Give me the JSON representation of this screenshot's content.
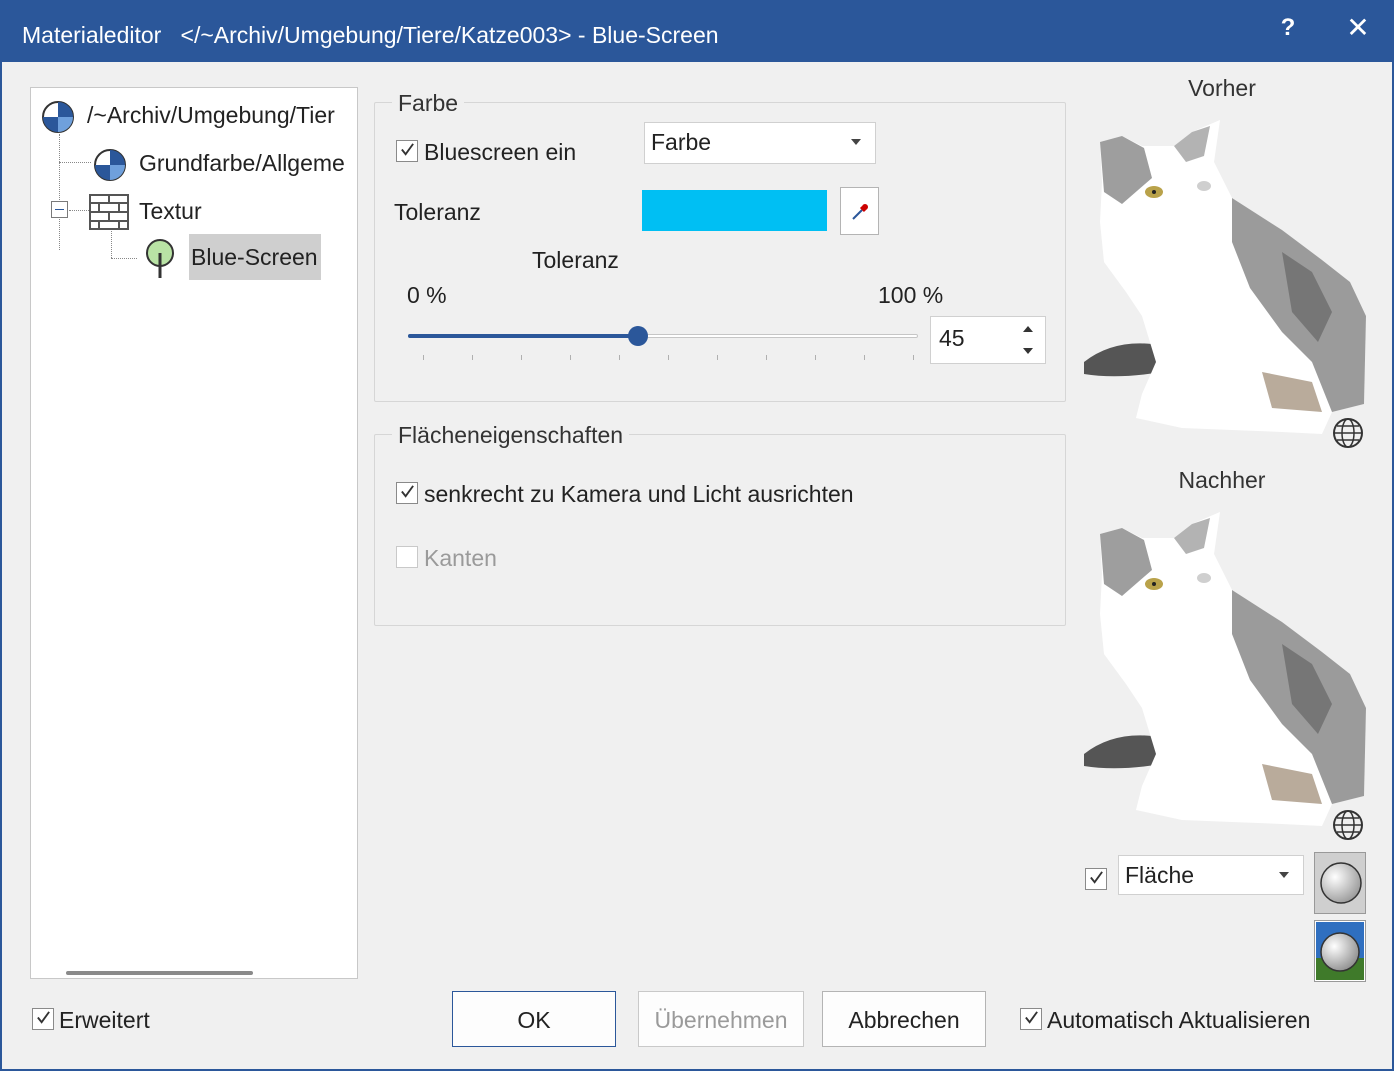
{
  "window": {
    "title": "Materialeditor   </~Archiv/Umgebung/Tiere/Katze003> - Blue-Screen",
    "help_label": "?",
    "close_label": "✕"
  },
  "tree": {
    "items": [
      {
        "label": "/~Archiv/Umgebung/Tier",
        "icon": "material-sphere-icon"
      },
      {
        "label": "Grundfarbe/Allgeme",
        "icon": "material-sphere-icon"
      },
      {
        "label": "Textur",
        "icon": "brick-wall-icon"
      },
      {
        "label": "Blue-Screen",
        "icon": "tree-icon",
        "selected": true
      }
    ]
  },
  "farbe_group": {
    "title": "Farbe",
    "bluescreen_checkbox": {
      "label": "Bluescreen ein",
      "checked": true
    },
    "mode_select": {
      "value": "Farbe"
    },
    "toleranz_color_label": "Toleranz",
    "color_swatch": "#00bff3",
    "slider": {
      "title": "Toleranz",
      "min_label": "0 %",
      "max_label": "100 %",
      "value": 45
    }
  },
  "flaechen_group": {
    "title": "Flächeneigenschaften",
    "align_checkbox": {
      "label": "senkrecht zu Kamera und Licht ausrichten",
      "checked": true
    },
    "kanten_checkbox": {
      "label": "Kanten",
      "checked": false,
      "disabled": true
    }
  },
  "preview": {
    "before_title": "Vorher",
    "after_title": "Nachher",
    "flaeche_checkbox": {
      "checked": true
    },
    "flaeche_select": {
      "value": "Fläche"
    }
  },
  "footer": {
    "erweitert": {
      "label": "Erweitert",
      "checked": true
    },
    "ok": "OK",
    "uebernehmen": "Übernehmen",
    "abbrechen": "Abbrechen",
    "auto_update": {
      "label": "Automatisch Aktualisieren",
      "checked": true
    }
  },
  "colors": {
    "accent": "#2b579a",
    "swatch": "#00bff3"
  }
}
